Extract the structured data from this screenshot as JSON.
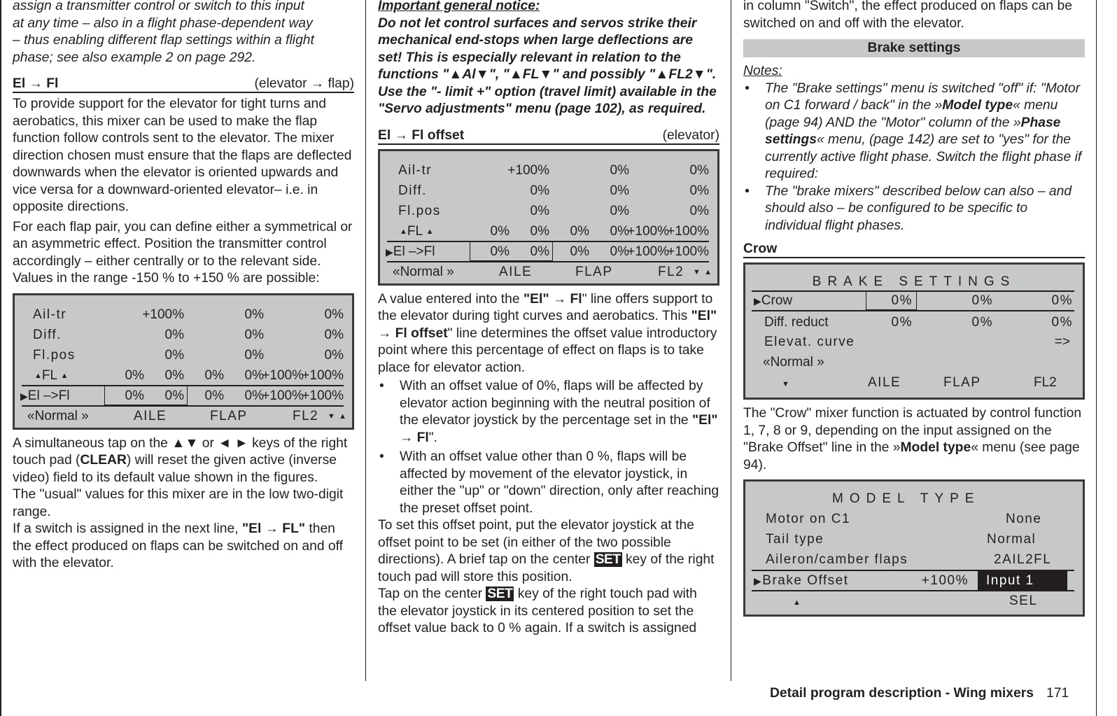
{
  "col1": {
    "intro_italic": [
      "assign a transmitter control or switch to this input",
      "at any time – also in a flight phase-dependent way",
      "– thus enabling different flap settings within a flight",
      "phase; see also example 2 on page 292."
    ],
    "section": {
      "title": "El → Fl",
      "subtitle": "(elevator → flap)"
    },
    "para1": "To provide support for the elevator for tight turns and aerobatics, this mixer can be used to make the flap function follow controls sent to the elevator. The mixer direction chosen must ensure that the flaps are deflected downwards when the elevator is oriented upwards and vice versa for a downward-oriented elevator– i.e. in opposite directions.",
    "para2": "For each flap pair, you can define either a symmetrical or an asymmetric effect. Position the transmitter control accordingly – either centrally or to the relevant side. Values in the range -150 % to +150 % are possible:",
    "para3_a": "A simultaneous tap on the ▲▼ or ◄ ► keys of the right touch pad (",
    "para3_b": "CLEAR",
    "para3_c": ") will reset the given active (inverse video) field to its default value shown in the figures.",
    "para4": "The \"usual\" values for this mixer are in the low two-digit range.",
    "para5_a": "If a switch is assigned in the next line, ",
    "para5_b": "\"El → FL\"",
    "para5_c": " then the effect produced on flaps can be switched on and off with the elevator."
  },
  "mixer_screen": {
    "rows": [
      {
        "label": "Ail-tr",
        "values": [
          "+100%",
          "0%",
          "0%"
        ]
      },
      {
        "label": "Diff.",
        "values": [
          "0%",
          "0%",
          "0%"
        ]
      },
      {
        "label": "Fl.pos",
        "values": [
          "0%",
          "0%",
          "0%"
        ]
      },
      {
        "label": "FL",
        "values": [
          "0%",
          "0%",
          "0%",
          "0%",
          "+100%",
          "+100%"
        ]
      },
      {
        "label": "El  –>Fl",
        "values": [
          "0%",
          "0%",
          "0%",
          "0%",
          "+100%",
          "+100%"
        ]
      }
    ],
    "footer": {
      "phase": "Normal",
      "col1": "AILE",
      "col2": "FLAP",
      "col3": "FL2"
    }
  },
  "col2": {
    "notice_title": "Important general notice:",
    "notice_body": "Do not let control surfaces and servos strike their mechanical end-stops when large deflections are set! This is especially relevant in relation to the functions \"▲Al▼\", \"▲FL▼\" and possibly \"▲FL2▼\". Use the \"- limit +\" option (travel limit) available in the \"Servo adjustments\" menu (page 102), as required.",
    "section": {
      "title": "El → Fl offset",
      "subtitle": "(elevator)"
    },
    "para1_a": "A value entered into the ",
    "para1_b": "\"El\"",
    "para1_c": " → ",
    "para1_d": "Fl",
    "para1_e": "\" line offers support to the elevator during tight curves and aerobatics. This ",
    "para1_f": "\"El\"",
    "para1_g": " → Fl offset",
    "para1_h": "\" line determines the offset value introductory point where this percentage of effect on flaps is to take place for elevator action.",
    "bullet1_a": "With an offset value of 0%, flaps will be affected by elevator action beginning with the neutral position of the elevator joystick by the percentage set in the ",
    "bullet1_b": "\"El\" → Fl",
    "bullet1_c": "\".",
    "bullet2": "With an offset value other than 0 %, flaps will be affected by movement of the elevator joystick, in either the \"up\" or \"down\" direction, only after reaching the preset offset point.",
    "para2_a": "To set this offset point, put the elevator joystick at the offset point to be set (in either of the two possible directions). A brief tap on the center ",
    "set_key": "SET",
    "para2_b": " key of the right touch pad will store this position.",
    "para3_a": "Tap on the center ",
    "para3_b": " key of the right touch pad with the elevator joystick in its centered position to set the offset value back to 0 % again. If a switch is assigned"
  },
  "col3": {
    "cont": "in column \"Switch\", the effect produced on flaps can be switched on and off with the elevator.",
    "banner": "Brake settings",
    "notes_title": "Notes:",
    "note1_a": "The \"Brake settings\" menu is switched \"off\" if: \"Motor on C1 forward / back\" in the »",
    "note1_b": "Model type",
    "note1_c": "« menu (page 94) AND the \"Motor\" column of the »",
    "note1_d": "Phase settings",
    "note1_e": "« menu, (page 142) are set to \"yes\" for the currently active flight phase. Switch the flight phase if required:",
    "note2": "The \"brake mixers\" described below can also – and should also – be configured to be specific to individual flight phases.",
    "crow_heading": "Crow",
    "crow_para_a": "The \"Crow\" mixer function is actuated by control function 1, 7, 8 or 9, depending on the input assigned on the \"Brake Offset\" line in the »",
    "crow_para_b": "Model type",
    "crow_para_c": "« menu (see page 94)."
  },
  "brake_screen": {
    "title": "BRAKE SETTINGS",
    "rows": [
      {
        "label": "Crow",
        "values": [
          "0%",
          "0%",
          "0%"
        ]
      },
      {
        "label": "Diff. reduct",
        "values": [
          "0%",
          "0%",
          "0%"
        ]
      },
      {
        "label": "Elevat. curve",
        "values": [
          "=>"
        ]
      }
    ],
    "phase": "Normal",
    "footer": {
      "col1": "AILE",
      "col2": "FLAP",
      "col3": "FL2"
    }
  },
  "model_screen": {
    "title": "MODEL TYPE",
    "rows": [
      {
        "label": "Motor  on  C1",
        "value": "None"
      },
      {
        "label": "Tail type",
        "value": "Normal"
      },
      {
        "label": "Aileron/camber flaps",
        "value": "2AIL2FL"
      },
      {
        "label": "Brake  Offset",
        "offset": "+100%",
        "value": "Input 1"
      }
    ],
    "footer_sel": "SEL"
  },
  "footer": {
    "title": "Detail program description - Wing mixers",
    "page": "171"
  }
}
